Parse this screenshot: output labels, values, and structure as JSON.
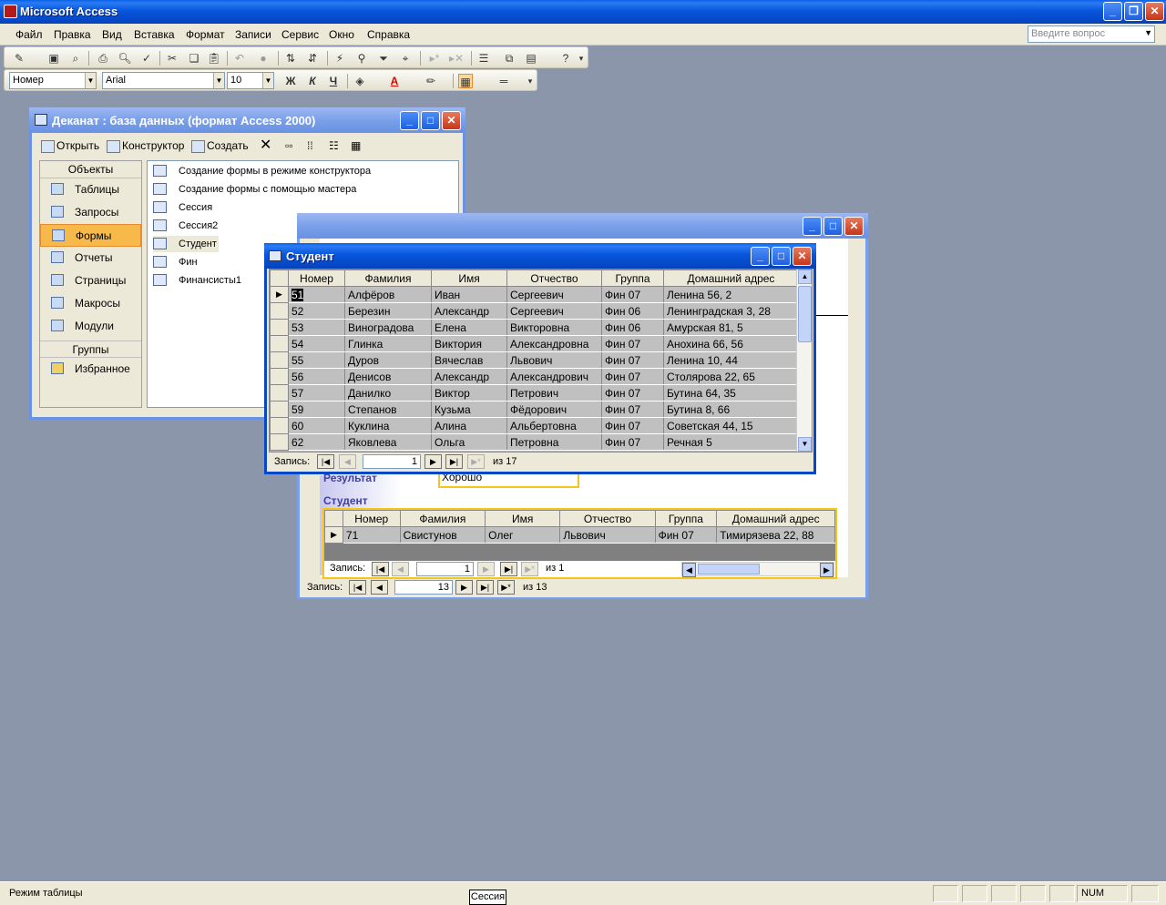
{
  "app": {
    "title": "Microsoft Access",
    "menu": [
      "Файл",
      "Правка",
      "Вид",
      "Вставка",
      "Формат",
      "Записи",
      "Сервис",
      "Окно",
      "Справка"
    ],
    "ask_placeholder": "Введите вопрос"
  },
  "format_bar": {
    "field": "Номер",
    "font": "Arial",
    "size": "10",
    "bold": "Ж",
    "italic": "К",
    "underline": "Ч",
    "font_color_glyph": "A"
  },
  "db_window": {
    "title": "Деканат : база данных (формат Access 2000)",
    "tools": {
      "open": "Открыть",
      "design": "Конструктор",
      "create": "Создать"
    },
    "objects_header": "Объекты",
    "objects": [
      "Таблицы",
      "Запросы",
      "Формы",
      "Отчеты",
      "Страницы",
      "Макросы",
      "Модули"
    ],
    "groups_header": "Группы",
    "groups": [
      "Избранное"
    ],
    "items": [
      "Создание формы в режиме конструктора",
      "Создание формы с помощью мастера",
      "Сессия",
      "Сессия2",
      "Студент",
      "Фин",
      "Финансисты1"
    ]
  },
  "session_form": {
    "result_label": "Результат",
    "result_value": "Хорошо",
    "subform_label": "Студент",
    "columns": [
      "Номер",
      "Фамилия",
      "Имя",
      "Отчество",
      "Группа",
      "Домашний адрес"
    ],
    "row": [
      "71",
      "Свистунов",
      "Олег",
      "Львович",
      "Фин 07",
      "Тимирязева 22, 88"
    ],
    "sub_nav": {
      "label": "Запись:",
      "current": "1",
      "of": "из 1"
    },
    "main_nav": {
      "label": "Запись:",
      "current": "13",
      "of": "из 13"
    }
  },
  "student_form": {
    "title": "Студент",
    "columns": [
      "Номер",
      "Фамилия",
      "Имя",
      "Отчество",
      "Группа",
      "Домашний адрес"
    ],
    "rows": [
      [
        "51",
        "Алфёров",
        "Иван",
        "Сергеевич",
        "Фин 07",
        "Ленина 56, 2"
      ],
      [
        "52",
        "Березин",
        "Александр",
        "Сергеевич",
        "Фин 06",
        "Ленинградская 3, 28"
      ],
      [
        "53",
        "Виноградова",
        "Елена",
        "Викторовна",
        "Фин 06",
        "Амурская 81, 5"
      ],
      [
        "54",
        "Глинка",
        "Виктория",
        "Александровна",
        "Фин 07",
        "Анохина 66, 56"
      ],
      [
        "55",
        "Дуров",
        "Вячеслав",
        "Львович",
        "Фин 07",
        "Ленина 10, 44"
      ],
      [
        "56",
        "Денисов",
        "Александр",
        "Александрович",
        "Фин 07",
        "Столярова 22, 65"
      ],
      [
        "57",
        "Данилко",
        "Виктор",
        "Петрович",
        "Фин 07",
        "Бутина 64, 35"
      ],
      [
        "59",
        "Степанов",
        "Кузьма",
        "Фёдорович",
        "Фин 07",
        "Бутина 8, 66"
      ],
      [
        "60",
        "Куклина",
        "Алина",
        "Альбертовна",
        "Фин 07",
        "Советская 44, 15"
      ],
      [
        "62",
        "Яковлева",
        "Ольга",
        "Петровна",
        "Фин 07",
        "Речная 5"
      ]
    ],
    "nav": {
      "label": "Запись:",
      "current": "1",
      "of": "из 17"
    }
  },
  "status": {
    "mode": "Режим таблицы",
    "num": "NUM",
    "taskbar_item": "Сессия"
  },
  "colors": {
    "accent": "#0648c8",
    "selection": "#f7b94a",
    "desktop": "#8c96aa"
  }
}
